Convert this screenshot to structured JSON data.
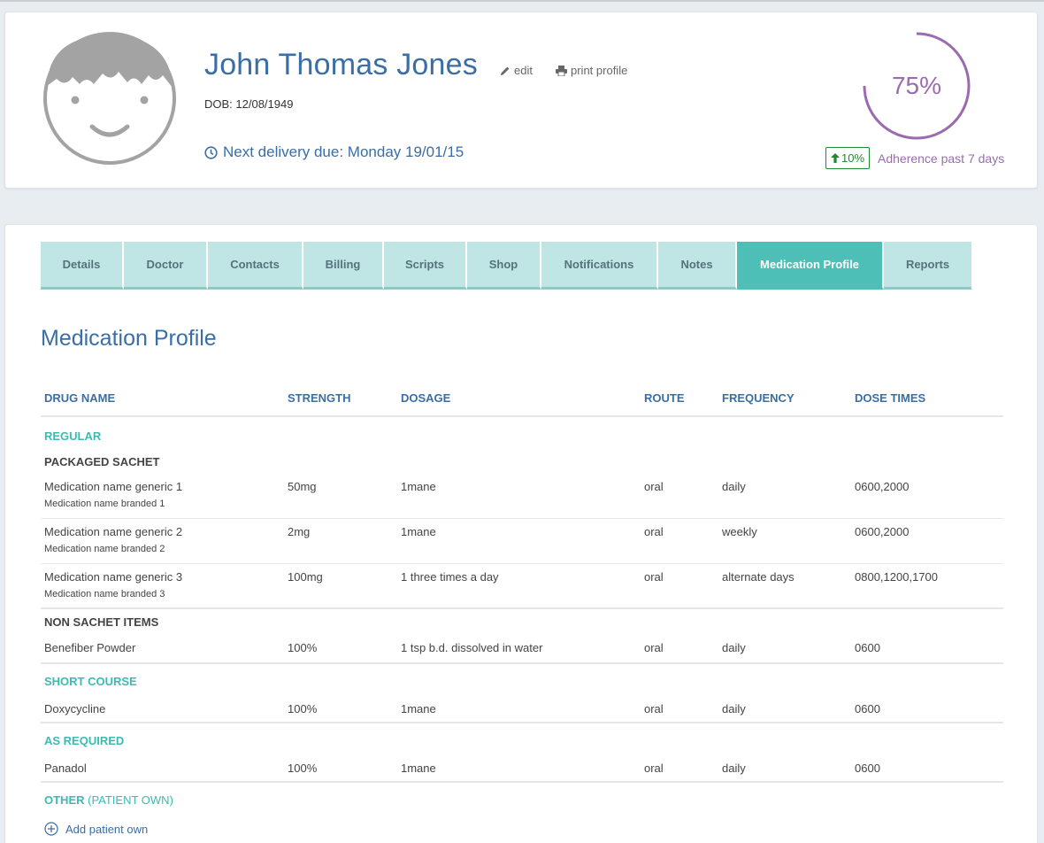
{
  "patient": {
    "name": "John Thomas Jones",
    "edit_label": "edit",
    "print_label": "print profile",
    "dob": "DOB: 12/08/1949",
    "next_delivery": "Next delivery due: Monday 19/01/15"
  },
  "adherence": {
    "percent": 75,
    "percent_label": "75%",
    "change_label": "10%",
    "label": "Adherence past 7 days",
    "accent_color": "#9b6bb0",
    "trend_color": "#1e8b2e"
  },
  "tabs": [
    {
      "label": "Details"
    },
    {
      "label": "Doctor"
    },
    {
      "label": "Contacts"
    },
    {
      "label": "Billing"
    },
    {
      "label": "Scripts"
    },
    {
      "label": "Shop"
    },
    {
      "label": "Notifications"
    },
    {
      "label": "Notes"
    },
    {
      "label": "Medication Profile",
      "active": true
    },
    {
      "label": "Reports"
    }
  ],
  "page_title": "Medication Profile",
  "table": {
    "columns": [
      "DRUG NAME",
      "STRENGTH",
      "DOSAGE",
      "ROUTE",
      "FREQUENCY",
      "DOSE TIMES"
    ],
    "regular": {
      "title": "REGULAR",
      "packaged_title": "PACKAGED SACHET",
      "packaged": [
        {
          "generic": "Medication name generic 1",
          "branded": "Medication name branded 1",
          "strength": "50mg",
          "dosage": "1mane",
          "route": "oral",
          "frequency": "daily",
          "dose_times": "0600,2000"
        },
        {
          "generic": "Medication name generic 2",
          "branded": "Medication name branded 2",
          "strength": "2mg",
          "dosage": "1mane",
          "route": "oral",
          "frequency": "weekly",
          "dose_times": "0600,2000"
        },
        {
          "generic": "Medication name generic 3",
          "branded": "Medication name branded 3",
          "strength": "100mg",
          "dosage": "1 three times a day",
          "route": "oral",
          "frequency": "alternate days",
          "dose_times": "0800,1200,1700"
        }
      ],
      "non_sachet_title": "NON SACHET ITEMS",
      "non_sachet": [
        {
          "generic": "Benefiber Powder",
          "strength": "100%",
          "dosage": "1 tsp b.d. dissolved in water",
          "route": "oral",
          "frequency": "daily",
          "dose_times": "0600"
        }
      ]
    },
    "short_course": {
      "title": "SHORT COURSE",
      "items": [
        {
          "generic": "Doxycycline",
          "strength": "100%",
          "dosage": "1mane",
          "route": "oral",
          "frequency": "daily",
          "dose_times": "0600"
        }
      ]
    },
    "as_required": {
      "title": "AS REQUIRED",
      "items": [
        {
          "generic": "Panadol",
          "strength": "100%",
          "dosage": "1mane",
          "route": "oral",
          "frequency": "daily",
          "dose_times": "0600"
        }
      ]
    },
    "other": {
      "title": "OTHER",
      "subtitle": "(PATIENT OWN)",
      "add_label": "Add patient own"
    }
  }
}
